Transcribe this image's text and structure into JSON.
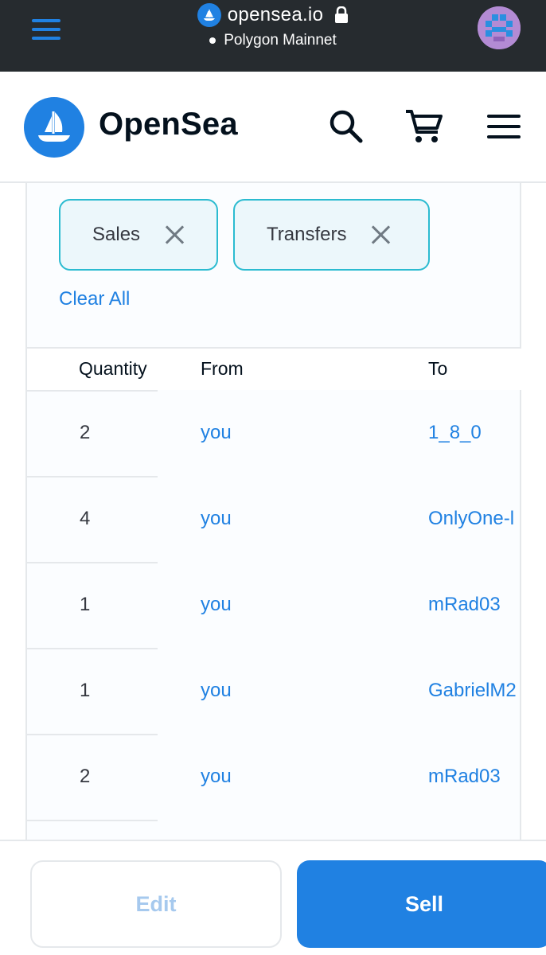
{
  "browser": {
    "url": "opensea.io",
    "network": "Polygon Mainnet"
  },
  "header": {
    "brand": "OpenSea"
  },
  "filters": {
    "chips": [
      {
        "label": "Sales"
      },
      {
        "label": "Transfers"
      }
    ],
    "clear_all": "Clear All"
  },
  "table": {
    "columns": [
      "Quantity",
      "From",
      "To"
    ],
    "rows": [
      {
        "quantity": "2",
        "from": "you",
        "to": "1_8_0"
      },
      {
        "quantity": "4",
        "from": "you",
        "to": "OnlyOne-l"
      },
      {
        "quantity": "1",
        "from": "you",
        "to": "mRad03"
      },
      {
        "quantity": "1",
        "from": "you",
        "to": "GabrielM2"
      },
      {
        "quantity": "2",
        "from": "you",
        "to": "mRad03"
      }
    ]
  },
  "actions": {
    "edit": "Edit",
    "sell": "Sell"
  },
  "colors": {
    "brand_blue": "#2081e2",
    "topbar": "#262b2f",
    "chip_border": "#2bbbd0"
  }
}
